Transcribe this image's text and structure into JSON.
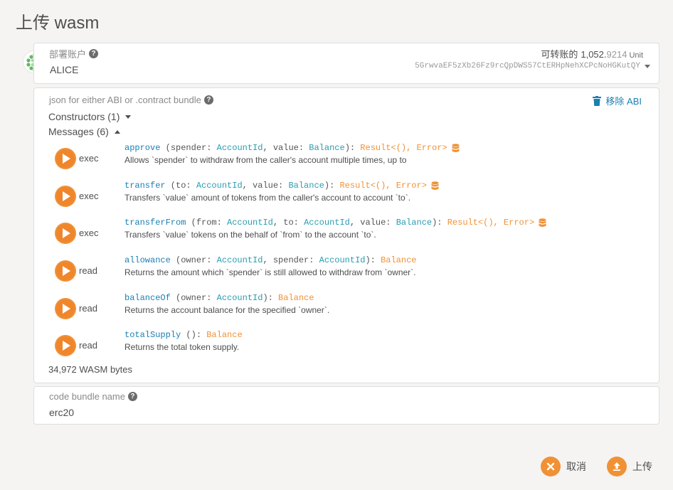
{
  "modal": {
    "title": "上传 wasm"
  },
  "account": {
    "label": "部署账户",
    "name": "ALICE",
    "balance_label": "可转账的",
    "balance_int": "1,052.",
    "balance_dec": "9214",
    "balance_unit": "Unit",
    "address": "5GrwvaEF5zXb26Fz9rcQpDWS57CtERHpNehXCPcNoHGKutQY"
  },
  "abi": {
    "label": "json for either ABI or .contract bundle",
    "remove_label": "移除 ABI",
    "constructors_label": "Constructors (1)",
    "messages_label": "Messages (6)",
    "messages": [
      {
        "kind": "exec",
        "name": "approve",
        "params_prefix": " (spender: ",
        "p1_type": "AccountId",
        "mid": ", value: ",
        "p2_type": "Balance",
        "mid2": "",
        "p3_type": "",
        "close": "): ",
        "ret": "Result<(), Error>",
        "mutates": true,
        "doc": "Allows `spender` to withdraw from the caller's account multiple times, up to"
      },
      {
        "kind": "exec",
        "name": "transfer",
        "params_prefix": " (to: ",
        "p1_type": "AccountId",
        "mid": ", value: ",
        "p2_type": "Balance",
        "mid2": "",
        "p3_type": "",
        "close": "): ",
        "ret": "Result<(), Error>",
        "mutates": true,
        "doc": "Transfers `value` amount of tokens from the caller's account to account `to`."
      },
      {
        "kind": "exec",
        "name": "transferFrom",
        "params_prefix": " (from: ",
        "p1_type": "AccountId",
        "mid": ", to: ",
        "p2_type": "AccountId",
        "mid2": ", value: ",
        "p3_type": "Balance",
        "close": "): ",
        "ret": "Result<(), Error>",
        "mutates": true,
        "doc": "Transfers `value` tokens on the behalf of `from` to the account `to`."
      },
      {
        "kind": "read",
        "name": "allowance",
        "params_prefix": " (owner: ",
        "p1_type": "AccountId",
        "mid": ", spender: ",
        "p2_type": "AccountId",
        "mid2": "",
        "p3_type": "",
        "close": "): ",
        "ret": "Balance",
        "mutates": false,
        "doc": "Returns the amount which `spender` is still allowed to withdraw from `owner`."
      },
      {
        "kind": "read",
        "name": "balanceOf",
        "params_prefix": " (owner: ",
        "p1_type": "AccountId",
        "mid": "",
        "p2_type": "",
        "mid2": "",
        "p3_type": "",
        "close": "): ",
        "ret": "Balance",
        "mutates": false,
        "doc": "Returns the account balance for the specified `owner`."
      },
      {
        "kind": "read",
        "name": "totalSupply",
        "params_prefix": " (",
        "p1_type": "",
        "mid": "",
        "p2_type": "",
        "mid2": "",
        "p3_type": "",
        "close": "): ",
        "ret": "Balance",
        "mutates": false,
        "doc": "Returns the total token supply."
      }
    ],
    "wasm_size": "34,972 WASM bytes"
  },
  "bundle": {
    "label": "code bundle name",
    "value": "erc20"
  },
  "footer": {
    "cancel_label": "取消",
    "upload_label": "上传"
  },
  "colors": {
    "accent": "#f19135",
    "link": "#1a7fb3",
    "type": "#2a9db1"
  },
  "icons": {
    "help": "help-icon",
    "trash": "trash-icon",
    "play": "play-icon",
    "database": "database-icon",
    "cancel": "close-icon",
    "upload": "upload-icon"
  }
}
